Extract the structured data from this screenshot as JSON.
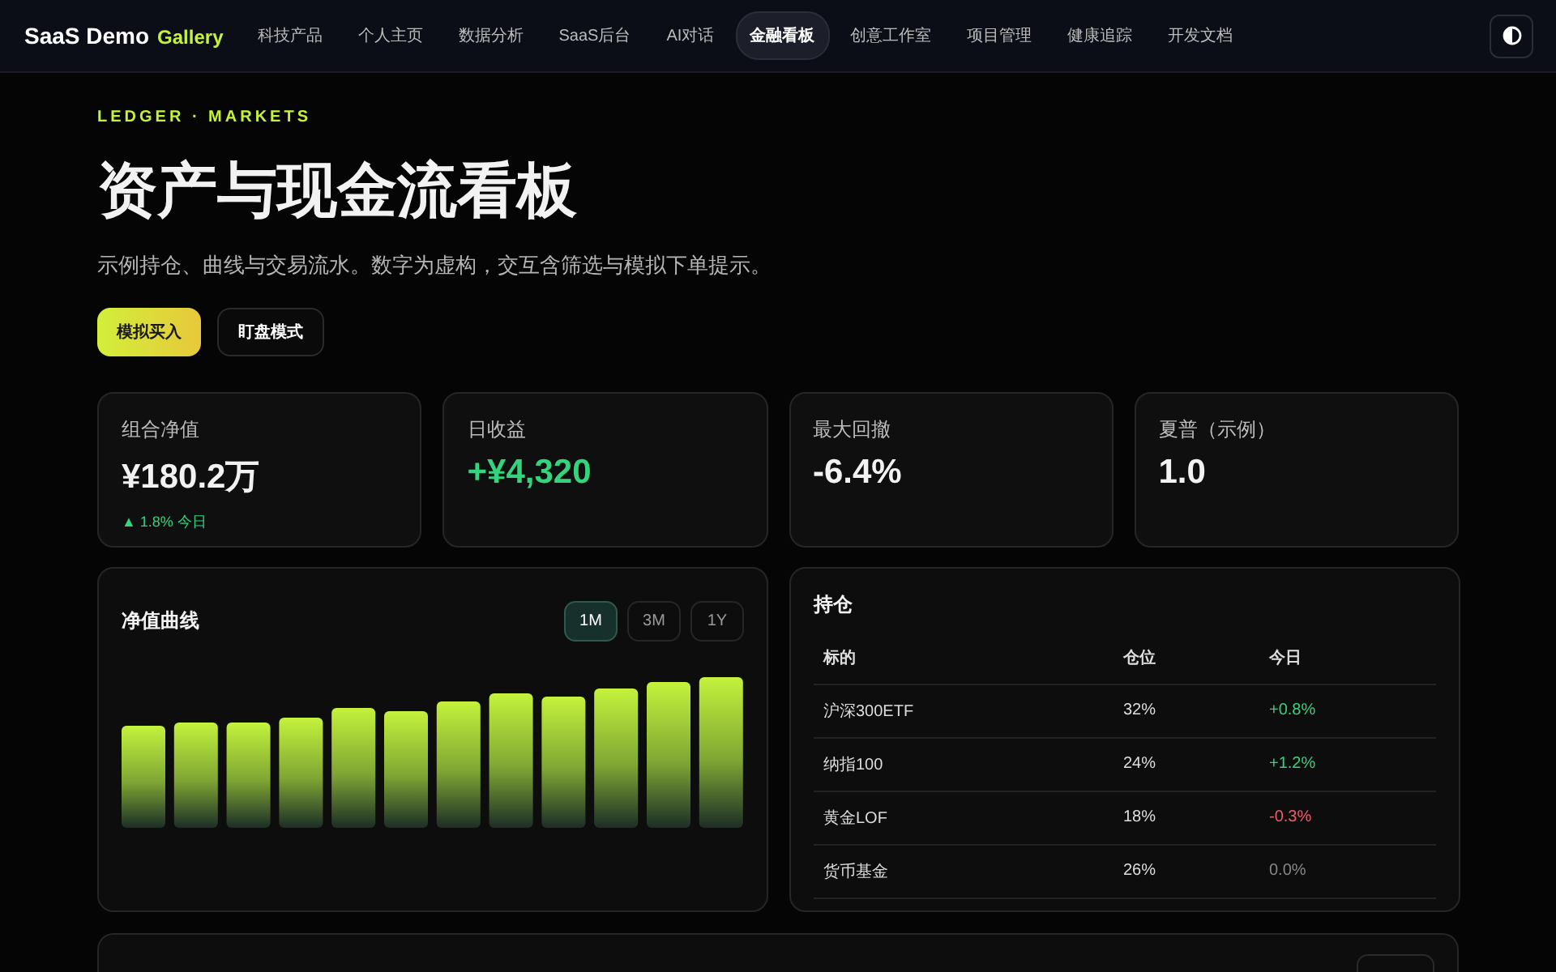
{
  "nav": {
    "brand": "SaaS Demo",
    "brand_tag": "Gallery",
    "items": [
      {
        "label": "科技产品",
        "selected": false
      },
      {
        "label": "个人主页",
        "selected": false
      },
      {
        "label": "数据分析",
        "selected": false
      },
      {
        "label": "SaaS后台",
        "selected": false
      },
      {
        "label": "AI对话",
        "selected": false
      },
      {
        "label": "金融看板",
        "selected": true
      },
      {
        "label": "创意工作室",
        "selected": false
      },
      {
        "label": "项目管理",
        "selected": false
      },
      {
        "label": "健康追踪",
        "selected": false
      },
      {
        "label": "开发文档",
        "selected": false
      }
    ]
  },
  "hero": {
    "eyebrow": "LEDGER · MARKETS",
    "title": "资产与现金流看板",
    "subtitle": "示例持仓、曲线与交易流水。数字为虚构，交互含筛选与模拟下单提示。",
    "buttons": [
      {
        "label": "模拟买入",
        "kind": "primary"
      },
      {
        "label": "盯盘模式",
        "kind": "secondary"
      }
    ]
  },
  "stats": [
    {
      "label": "组合净值",
      "value": "¥180.2万",
      "kind": "neutral",
      "note": "▲ 1.8% 今日"
    },
    {
      "label": "日收益",
      "value": "+¥4,320",
      "kind": "up"
    },
    {
      "label": "最大回撤",
      "value": "-6.4%",
      "kind": "neutral"
    },
    {
      "label": "夏普（示例）",
      "value": "1.0",
      "kind": "neutral"
    }
  ],
  "nav_chart": {
    "title": "净值曲线",
    "ranges": [
      {
        "label": "1M",
        "selected": true
      },
      {
        "label": "3M",
        "selected": false
      },
      {
        "label": "1Y",
        "selected": false
      }
    ]
  },
  "holdings": {
    "title": "持仓",
    "columns": [
      "标的",
      "仓位",
      "今日"
    ],
    "rows": [
      {
        "name": "沪深300ETF",
        "weight": "32%",
        "change": "+0.8%",
        "kind": "up"
      },
      {
        "name": "纳指100",
        "weight": "24%",
        "change": "+1.2%",
        "kind": "up"
      },
      {
        "name": "黄金LOF",
        "weight": "18%",
        "change": "-0.3%",
        "kind": "down"
      },
      {
        "name": "货币基金",
        "weight": "26%",
        "change": "0.0%",
        "kind": "flat"
      }
    ]
  }
}
